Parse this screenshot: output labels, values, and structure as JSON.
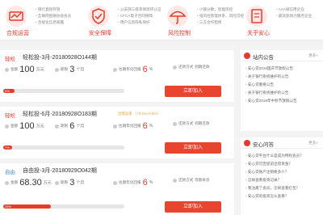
{
  "features": [
    {
      "title": "合规运营",
      "items": [
        "银行直接存管",
        "互联网金融协会会员",
        "合规化信息披露"
      ]
    },
    {
      "title": "安全保障",
      "items": [
        "公安部三级等保测评认证",
        "CFCA电子合同保障",
        "用户信息隐私保护"
      ]
    },
    {
      "title": "风险控制",
      "items": [
        "小额分散，智能风控",
        "强风控管理体系，风险可控",
        "三方合作担保"
      ]
    },
    {
      "title": "关乎安心",
      "items": [
        "AAA级信用企业",
        "最具影响力服务企业",
        ""
      ]
    }
  ],
  "products": [
    {
      "tag": "轻松",
      "name": "轻松投-3月-20180928O144期",
      "promo": "",
      "amount_label": "金额",
      "amount": "100",
      "amount_unit": "万元",
      "term_label": "期限",
      "term": "3",
      "term_unit": "个月",
      "rate_label": "往期年化回报",
      "rate": "6",
      "rate_unit": "%",
      "method_label": "还款方式",
      "method": "到期还款",
      "progress": 9,
      "progress_label": "9%",
      "button": "立即加入"
    },
    {
      "tag": "轻松",
      "name": "轻松投-6月-20180928O183期",
      "promo": "出借返现 （+0.2%~0.6%）",
      "amount_label": "金额",
      "amount": "100",
      "amount_unit": "万元",
      "term_label": "期限",
      "term": "6",
      "term_unit": "个月",
      "rate_label": "往期年化回报",
      "rate": "6",
      "rate_unit": "%",
      "method_label": "还款方式",
      "method": "到期还款",
      "progress": 7,
      "progress_label": "7%",
      "button": "立即加入"
    },
    {
      "tag": "自由",
      "name": "自由投-3月-20180929O042期",
      "promo": "",
      "amount_label": "金额",
      "amount": "68.30",
      "amount_unit": "万元",
      "term_label": "期限",
      "term": "3",
      "term_unit": "个月",
      "rate_label": "往期年化回报",
      "rate": "6",
      "rate_unit": "%",
      "method_label": "还款方式",
      "method": "等额本息",
      "progress": 39,
      "progress_label": "39%",
      "button": "立即加入"
    }
  ],
  "notice": {
    "title": "站内公告",
    "more": "更多>",
    "items": [
      "安心贷2018国庆节放假公告",
      "关于银行系统维护的公告",
      "安心贷重要公告",
      "关于银行系统维护的公告",
      "安心贷2018年中秋节放假公告"
    ]
  },
  "qa": {
    "title": "安心问答",
    "more": "更多>",
    "items": [
      "安心贷平台什么是成为特权会员？",
      "安心贷可否提前出借资金？",
      "安心贷账户注销要多少？",
      "怎样查看投资记录？",
      "我注册了会员，怎样查看红包？",
      "安心贷的投资怎么查看？"
    ]
  }
}
